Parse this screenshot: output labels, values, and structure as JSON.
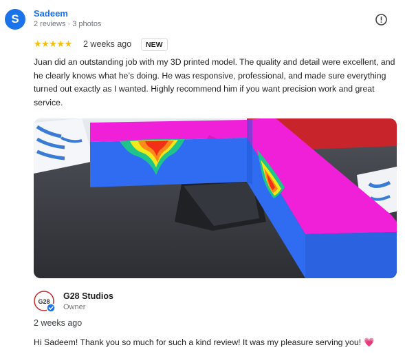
{
  "review": {
    "avatar_initial": "S",
    "reviewer_name": "Sadeem",
    "reviewer_meta": "2 reviews · 3 photos",
    "stars": "★★★★★",
    "rating": 5,
    "date": "2 weeks ago",
    "badge": "NEW",
    "text": "Juan did an outstanding job with my 3D printed model. The quality and detail were excellent, and he clearly knows what he’s doing. He was responsive, professional, and made sure everything turned out exactly as I wanted. Highly recommend him if you want precision work and great service."
  },
  "owner_reply": {
    "logo_text": "G28",
    "owner_name": "G28 Studios",
    "owner_role": "Owner",
    "date": "2 weeks ago",
    "text": "Hi Sadeem! Thank you so much for such a kind review! It was my pleasure serving you!",
    "emoji": "💗"
  },
  "icons": {
    "report": "report-icon",
    "verified": "verified-check-icon"
  },
  "colors": {
    "link_blue": "#1a73e8",
    "star_yellow": "#fbbc04",
    "model_magenta": "#e81fd0",
    "model_blue": "#2b6bf0"
  }
}
